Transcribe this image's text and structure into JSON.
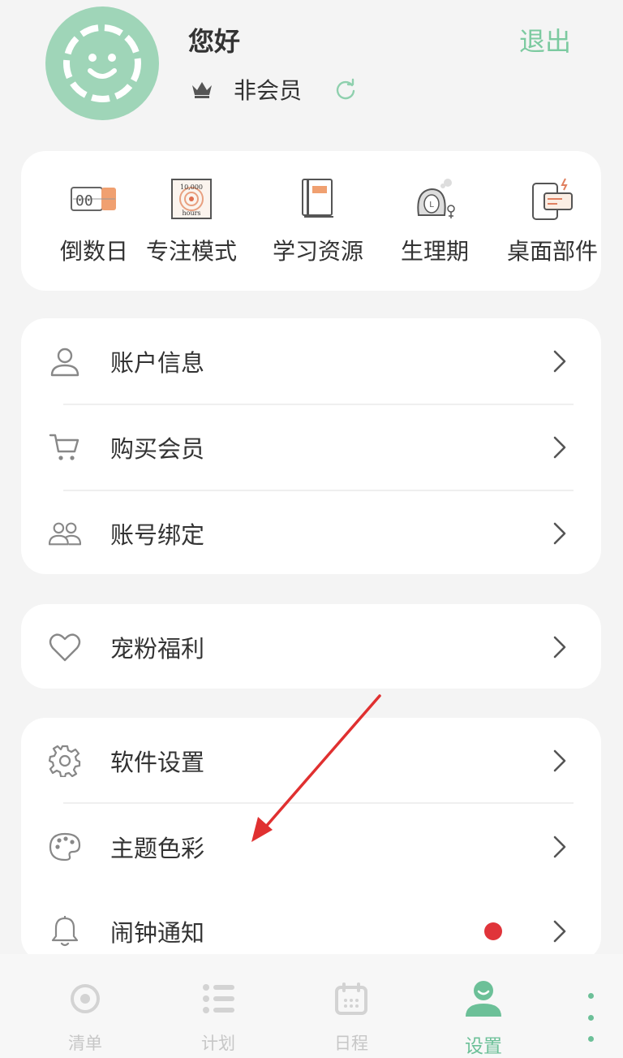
{
  "header": {
    "greeting": "您好",
    "membership": "非会员",
    "logout_label": "退出"
  },
  "tools": [
    {
      "label": "倒数日",
      "icon": "countdown-icon"
    },
    {
      "label": "专注模式",
      "icon": "focus-10000-hours-icon"
    },
    {
      "label": "学习资源",
      "icon": "book-icon"
    },
    {
      "label": "生理期",
      "icon": "period-tracker-icon"
    },
    {
      "label": "桌面部件",
      "icon": "desktop-widget-icon"
    }
  ],
  "tool_icon_text": {
    "countdown": "00",
    "focus_top": "10,000",
    "focus_bottom": "hours"
  },
  "account_section": [
    {
      "label": "账户信息",
      "icon": "user-icon"
    },
    {
      "label": "购买会员",
      "icon": "cart-icon"
    },
    {
      "label": "账号绑定",
      "icon": "users-link-icon"
    }
  ],
  "welfare_section": [
    {
      "label": "宠粉福利",
      "icon": "heart-icon"
    }
  ],
  "settings_section": [
    {
      "label": "软件设置",
      "icon": "gear-icon"
    },
    {
      "label": "主题色彩",
      "icon": "palette-icon"
    },
    {
      "label": "闹钟通知",
      "icon": "bell-icon",
      "badge": true
    }
  ],
  "bottom_nav": [
    {
      "label": "清单",
      "icon": "list-target-icon",
      "active": false
    },
    {
      "label": "计划",
      "icon": "plan-list-icon",
      "active": false
    },
    {
      "label": "日程",
      "icon": "calendar-icon",
      "active": false
    },
    {
      "label": "设置",
      "icon": "profile-icon",
      "active": true
    }
  ],
  "colors": {
    "accent": "#6cc098",
    "avatar_bg": "#9fd5b8",
    "badge": "#e0343a",
    "annotation_arrow": "#e03030"
  }
}
